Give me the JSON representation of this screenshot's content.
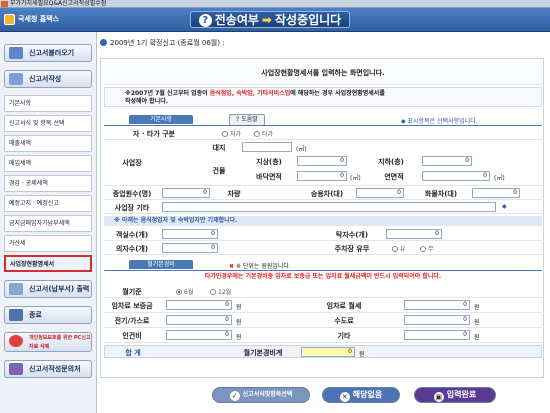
{
  "window_title": "부가가치세필요Q&A신고서작성필수점",
  "app_logo": "국세청 홈택스",
  "status_banner": {
    "left": "전송여부",
    "right": "작성중입니다"
  },
  "subtitle": "2009년 1기 확정신고 (종료월 06월) :",
  "sidebar": {
    "top_buttons": [
      "신고서불러오기",
      "신고서작성"
    ],
    "menu": [
      "기본사항",
      "신고서식 및 항목 선택",
      "매출세액",
      "매입세액",
      "경감 · 공제세액",
      "예정고지 · 예정신고",
      "금지금매입자기납부세액",
      "가산세",
      "사업장현황명세서"
    ],
    "selected_index": 8,
    "bottom_buttons": [
      "신고서(납부서) 출력",
      "종료",
      "개인정보보호를 위한 PC신고자료 삭제",
      "신고서작성문의처"
    ]
  },
  "intro": "사업장현황명세서를 입력하는 화면입니다.",
  "notice": {
    "prefix": "※2007년 7월 신고부터 업종이 ",
    "hl1": "음식점업, 숙박업, 기타서비스업",
    "suffix": "에 해당하는 경우 사업장현황명세서를",
    "line2": "작성해야 합니다."
  },
  "basic": {
    "tab": "기본사항",
    "help_button": "도움말",
    "note": "◆ 표시항목은 선택사항입니다.",
    "ownership_label": "자 · 타가 구분",
    "ownership_options": [
      "자가",
      "타가"
    ],
    "site_label": "사업장",
    "land_label": "대지",
    "land_value": "",
    "land_unit": "(㎡)",
    "building_label": "건물",
    "above_label": "지상(층)",
    "above_value": "0",
    "below_label": "지하(층)",
    "below_value": "0",
    "floor_area_label": "바닥면적",
    "floor_area_value": "0",
    "floor_area_unit": "(㎡)",
    "total_area_label": "연면적",
    "total_area_value": "0",
    "total_area_unit": "(㎡)",
    "employees_label": "종업원수(명)",
    "employees_value": "0",
    "vehicle_label": "차량",
    "car_label": "승용차(대)",
    "car_value": "0",
    "truck_label": "화물차(대)",
    "truck_value": "0",
    "site_other_label": "사업장 기타",
    "site_other_value": ""
  },
  "food_section": {
    "note": "※ 아래는 음식점업자 및 숙박업자만 기재합니다.",
    "seats_label": "객실수(개)",
    "seats_value": "0",
    "tables_label": "탁자수(개)",
    "tables_value": "0",
    "chairs_label": "의자수(개)",
    "chairs_value": "0",
    "parking_label": "주차장 유무",
    "parking_options": [
      "유",
      "무"
    ]
  },
  "expense": {
    "tab": "월기본경비",
    "note": "※ 단위는 원원입니다.",
    "warning": "타가인경우에는 기본경비중 임차료 보증금 또는 임차료 월세금액이 반드시 입력되어야 합니다.",
    "month_label": "월기준",
    "month_options": [
      "6월",
      "12월"
    ],
    "deposit_label": "임차료 보증금",
    "deposit_value": "0",
    "rent_label": "임차료 월세",
    "rent_value": "0",
    "power_label": "전기/가스료",
    "power_value": "0",
    "water_label": "수도료",
    "water_value": "0",
    "labor_label": "인건비",
    "labor_value": "0",
    "other_label": "기타",
    "other_value": "0",
    "currency": "원",
    "total_row_label": "합 계",
    "total_label": "월기본경비계",
    "total_value": "0"
  },
  "bottom_buttons": {
    "check": "신고서식및항목선택",
    "skip": "해당없음",
    "done": "입력완료"
  },
  "colors": {
    "accent": "#2f5f9f",
    "highlight": "#e2241e",
    "selected_border": "#d23030"
  }
}
